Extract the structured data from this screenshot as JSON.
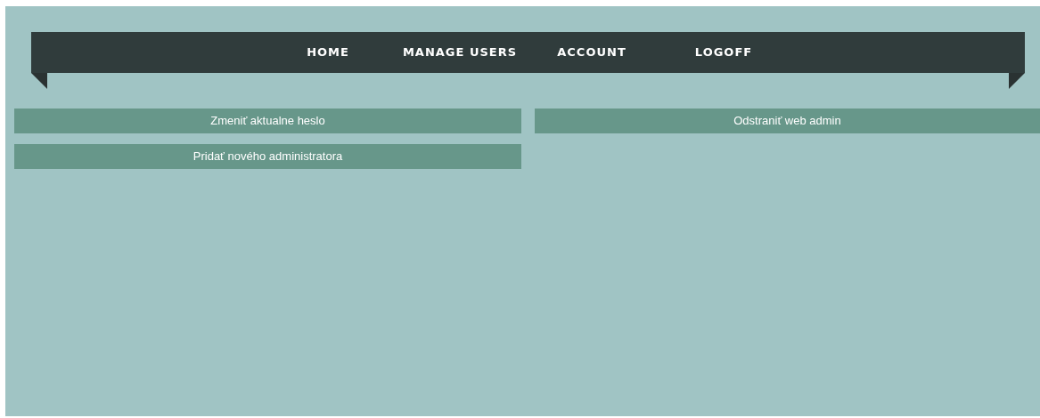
{
  "nav": {
    "items": [
      {
        "label": "HOME"
      },
      {
        "label": "MANAGE USERS"
      },
      {
        "label": "ACCOUNT"
      },
      {
        "label": "LOGOFF"
      }
    ]
  },
  "actions": {
    "left": [
      "Zmeniť aktualne heslo",
      "Pridať nového administratora"
    ],
    "right": [
      "Odstraniť web admin"
    ]
  }
}
